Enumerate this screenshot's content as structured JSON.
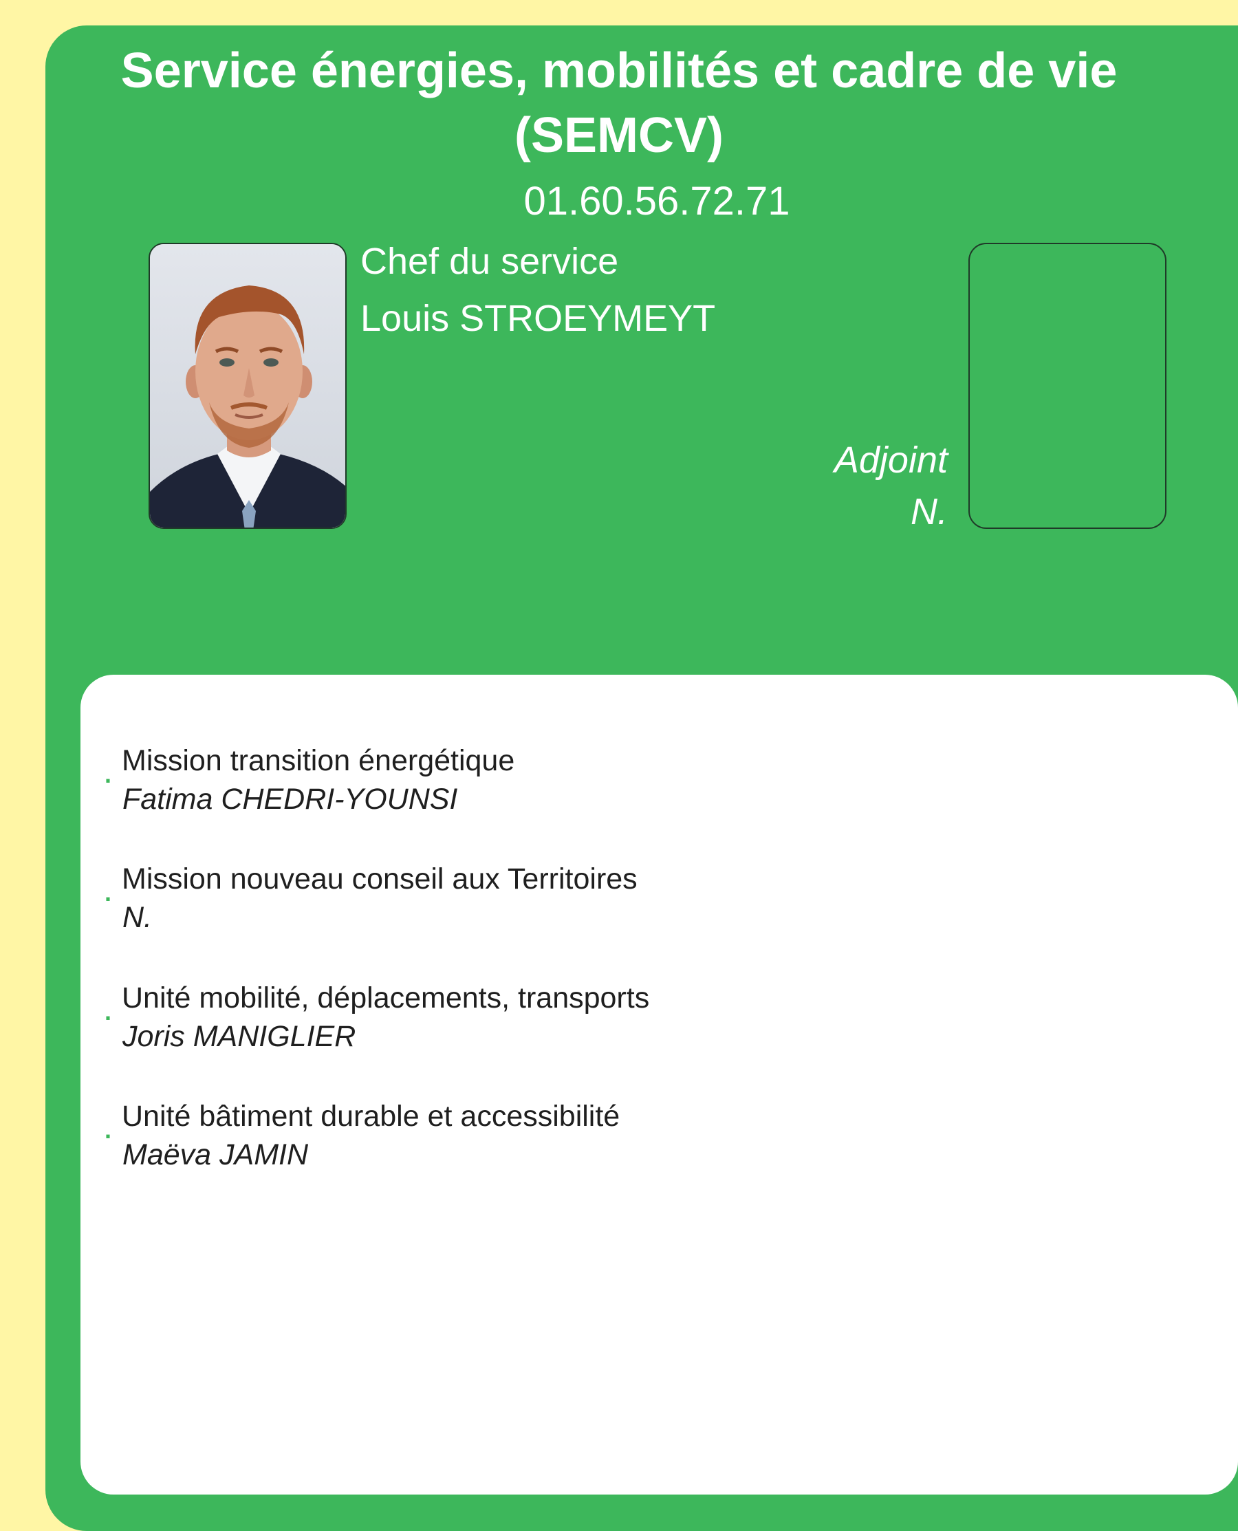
{
  "header": {
    "title_line1": "Service énergies, mobilités et cadre de vie",
    "title_line2": "(SEMCV)",
    "phone": "01.60.56.72.71"
  },
  "chief": {
    "role": "Chef du service",
    "name": "Louis STROEYMEYT"
  },
  "deputy": {
    "role": "Adjoint",
    "name": "N."
  },
  "units": [
    {
      "label": "Mission transition énergétique",
      "person": "Fatima CHEDRI-YOUNSI"
    },
    {
      "label": "Mission nouveau conseil aux Territoires",
      "person": "N."
    },
    {
      "label": "Unité mobilité, déplacements, transports",
      "person": "Joris MANIGLIER"
    },
    {
      "label": "Unité bâtiment durable et accessibilité",
      "person": "Maëva JAMIN"
    }
  ],
  "bullet": ".",
  "colors": {
    "background": "#fff6a5",
    "panel": "#3db75b",
    "card": "#ffffff",
    "text_dark": "#1f1f1f"
  }
}
